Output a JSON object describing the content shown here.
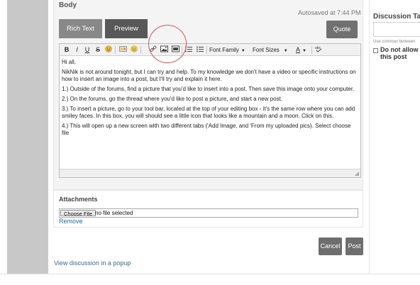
{
  "editor": {
    "section_label": "Body",
    "autosaved": "Autosaved at 7:44 PM",
    "tabs": {
      "rich_text": "Rich Text",
      "preview": "Preview"
    },
    "quote_label": "Quote",
    "toolbar": {
      "bold": "B",
      "italic": "I",
      "underline": "U",
      "strike": "S",
      "font_family": "Font Family",
      "font_sizes": "Font Sizes",
      "text_color": "A"
    },
    "content": [
      "Hi all,",
      "NikNik is not around tonight, but I can try and help. To my knowledge we don't have a video or specific instructions on how to insert an image into a post, but I'll try and explain it here.",
      "1.) Outside of the forums, find a picture that you'd like to insert into a post. Then save this image onto your computer.",
      "2.) On the forums, go the thread where you'd like to post a picture, and start a new post.",
      "3.) To insert a picture, go to your tool bar, located at the top of your editing box - it's the same row where you can add smiley faces. In this box, you will should see a little icon that looks like a mountain and a moon. Click on this.",
      "4.) This will open up a new screen with two different tabs ('Add Image, and 'From my uploaded pics). Select choose file"
    ]
  },
  "attachments": {
    "title": "Attachments",
    "choose_file": "Choose File",
    "no_file": "no file selected",
    "remove": "Remove"
  },
  "actions": {
    "cancel": "Cancel",
    "post": "Post"
  },
  "footer": {
    "popup_link": "View discussion in a popup"
  },
  "sidebar": {
    "tags_title": "Discussion Tag",
    "tags_hint": "Use commas between",
    "allow_label_line1": "Do not allow",
    "allow_label_line2": "this post"
  },
  "colors": {
    "accent_link": "#2e6ea8",
    "button_dark": "#6e6e6e",
    "highlight_circle": "#e05555"
  }
}
